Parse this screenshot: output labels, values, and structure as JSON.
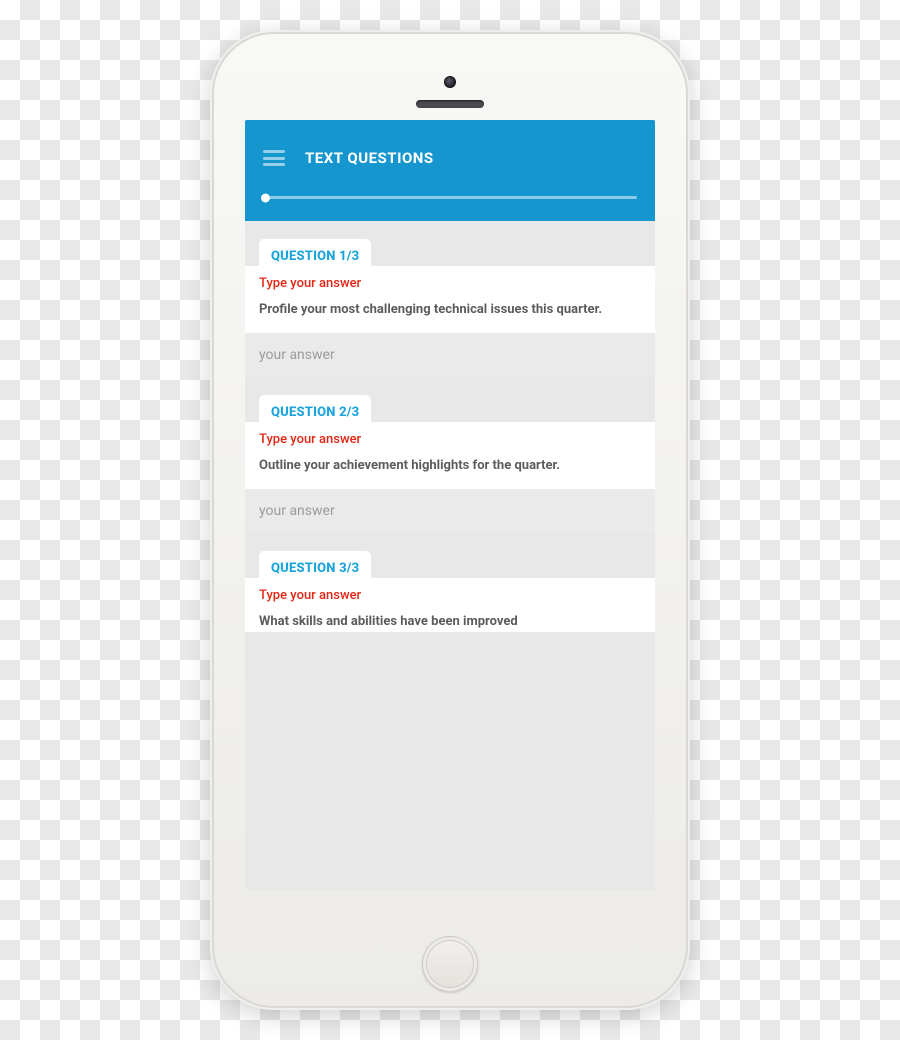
{
  "app": {
    "title": "TEXT QUESTIONS"
  },
  "progress": {
    "current": 1,
    "total": 3
  },
  "answer_placeholder": "your answer",
  "questions": [
    {
      "tag": "QUESTION 1/3",
      "instruction": "Type your answer",
      "prompt": "Profile your most challenging technical issues this quarter."
    },
    {
      "tag": "QUESTION 2/3",
      "instruction": "Type your answer",
      "prompt": "Outline your achievement highlights for the quarter."
    },
    {
      "tag": "QUESTION 3/3",
      "instruction": "Type your answer",
      "prompt": "What skills and abilities have been improved"
    }
  ]
}
